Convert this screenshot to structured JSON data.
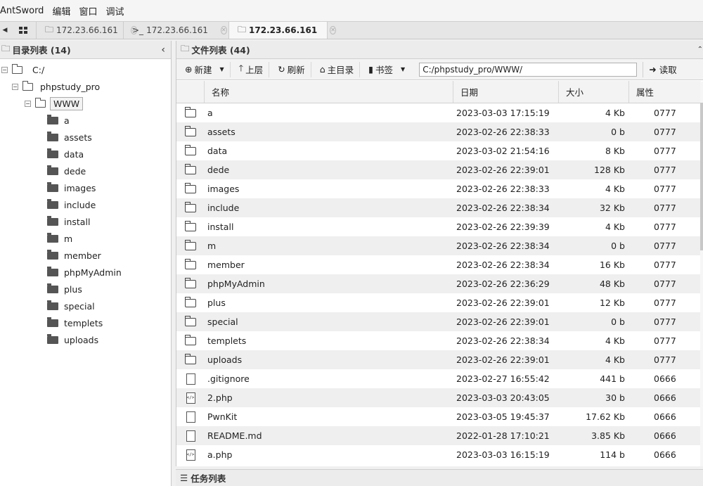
{
  "menubar": {
    "items": [
      "AntSword",
      "编辑",
      "窗口",
      "调试"
    ]
  },
  "tabs": [
    {
      "icon": "folder-icon",
      "label": "172.23.66.161",
      "active": false
    },
    {
      "icon": "terminal-icon",
      "label": "172.23.66.161",
      "active": false
    },
    {
      "icon": "folder-icon",
      "label": "172.23.66.161",
      "active": true
    }
  ],
  "left_panel": {
    "title": "目录列表 (14)",
    "tree": {
      "root": "C:/",
      "level1": "phpstudy_pro",
      "level2": "WWW",
      "children": [
        "a",
        "assets",
        "data",
        "dede",
        "images",
        "include",
        "install",
        "m",
        "member",
        "phpMyAdmin",
        "plus",
        "special",
        "templets",
        "uploads"
      ]
    }
  },
  "right_panel": {
    "title": "文件列表 (44)",
    "toolbar": {
      "new_label": "新建",
      "up_label": "上层",
      "refresh_label": "刷新",
      "home_label": "主目录",
      "bookmark_label": "书签",
      "path_value": "C:/phpstudy_pro/WWW/",
      "read_label": "读取"
    },
    "columns": [
      "名称",
      "日期",
      "大小",
      "属性"
    ],
    "rows": [
      {
        "type": "folder",
        "name": "a",
        "date": "2023-03-03 17:15:19",
        "size": "4 Kb",
        "attr": "0777"
      },
      {
        "type": "folder",
        "name": "assets",
        "date": "2023-02-26 22:38:33",
        "size": "0 b",
        "attr": "0777"
      },
      {
        "type": "folder",
        "name": "data",
        "date": "2023-03-02 21:54:16",
        "size": "8 Kb",
        "attr": "0777"
      },
      {
        "type": "folder",
        "name": "dede",
        "date": "2023-02-26 22:39:01",
        "size": "128 Kb",
        "attr": "0777"
      },
      {
        "type": "folder",
        "name": "images",
        "date": "2023-02-26 22:38:33",
        "size": "4 Kb",
        "attr": "0777"
      },
      {
        "type": "folder",
        "name": "include",
        "date": "2023-02-26 22:38:34",
        "size": "32 Kb",
        "attr": "0777"
      },
      {
        "type": "folder",
        "name": "install",
        "date": "2023-02-26 22:39:39",
        "size": "4 Kb",
        "attr": "0777"
      },
      {
        "type": "folder",
        "name": "m",
        "date": "2023-02-26 22:38:34",
        "size": "0 b",
        "attr": "0777"
      },
      {
        "type": "folder",
        "name": "member",
        "date": "2023-02-26 22:38:34",
        "size": "16 Kb",
        "attr": "0777"
      },
      {
        "type": "folder",
        "name": "phpMyAdmin",
        "date": "2023-02-26 22:36:29",
        "size": "48 Kb",
        "attr": "0777"
      },
      {
        "type": "folder",
        "name": "plus",
        "date": "2023-02-26 22:39:01",
        "size": "12 Kb",
        "attr": "0777"
      },
      {
        "type": "folder",
        "name": "special",
        "date": "2023-02-26 22:39:01",
        "size": "0 b",
        "attr": "0777"
      },
      {
        "type": "folder",
        "name": "templets",
        "date": "2023-02-26 22:38:34",
        "size": "4 Kb",
        "attr": "0777"
      },
      {
        "type": "folder",
        "name": "uploads",
        "date": "2023-02-26 22:39:01",
        "size": "4 Kb",
        "attr": "0777"
      },
      {
        "type": "file",
        "name": ".gitignore",
        "date": "2023-02-27 16:55:42",
        "size": "441 b",
        "attr": "0666"
      },
      {
        "type": "code",
        "name": "2.php",
        "date": "2023-03-03 20:43:05",
        "size": "30 b",
        "attr": "0666"
      },
      {
        "type": "file",
        "name": "PwnKit",
        "date": "2023-03-05 19:45:37",
        "size": "17.62 Kb",
        "attr": "0666"
      },
      {
        "type": "file",
        "name": "README.md",
        "date": "2022-01-28 17:10:21",
        "size": "3.85 Kb",
        "attr": "0666"
      },
      {
        "type": "code",
        "name": "a.php",
        "date": "2023-03-03 16:15:19",
        "size": "114 b",
        "attr": "0666"
      }
    ]
  },
  "task_panel": {
    "title": "任务列表"
  }
}
